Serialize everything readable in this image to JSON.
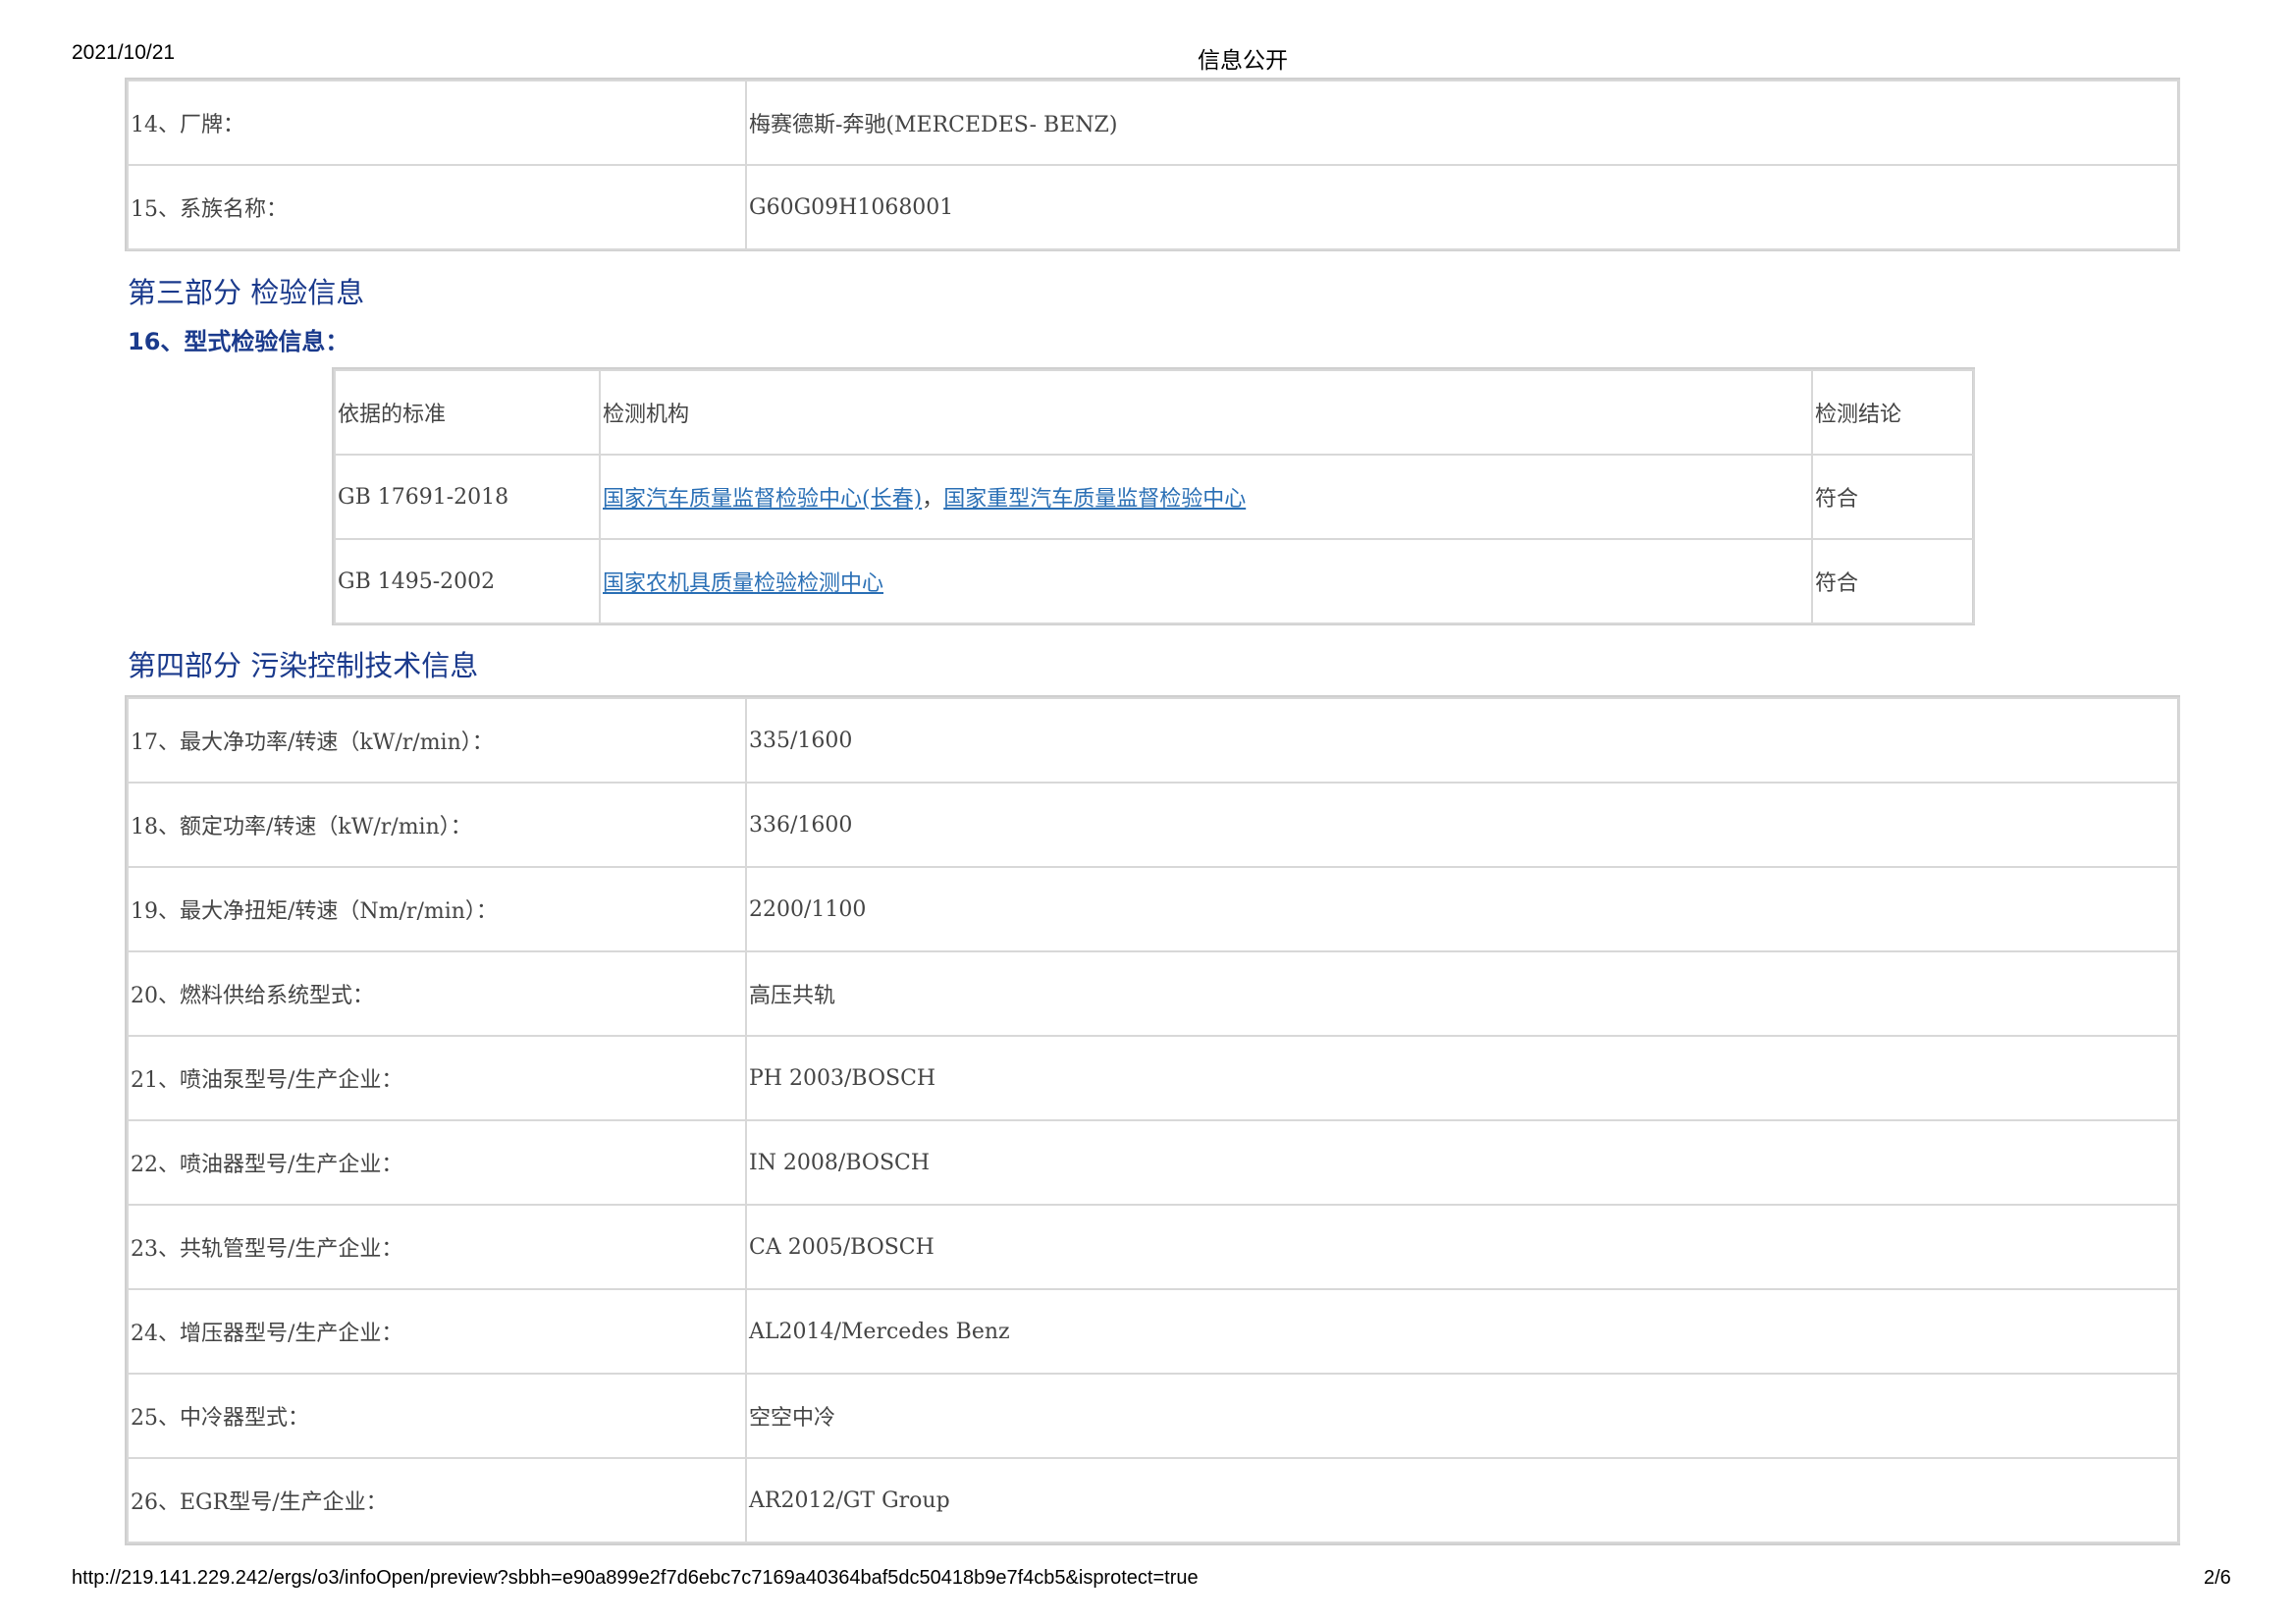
{
  "header": {
    "date": "2021/10/21",
    "title": "信息公开"
  },
  "footer": {
    "url": "http://219.141.229.242/ergs/o3/infoOpen/preview?sbbh=e90a899e2f7d6ebc7c7169a40364baf5dc50418b9e7f4cb5&isprotect=true",
    "page": "2/6"
  },
  "part2_rows": [
    {
      "label": "14、厂牌：",
      "value": "梅赛德斯-奔驰(MERCEDES- BENZ)"
    },
    {
      "label": "15、系族名称：",
      "value": "G60G09H1068001"
    }
  ],
  "part3": {
    "title": "第三部分 检验信息",
    "subtitle": "16、型式检验信息：",
    "headers": {
      "standard": "依据的标准",
      "agency": "检测机构",
      "result": "检测结论"
    },
    "rows": [
      {
        "standard": "GB 17691-2018",
        "agency_link1": "国家汽车质量监督检验中心(长春)",
        "separator": "，",
        "agency_link2": "国家重型汽车质量监督检验中心",
        "result": "符合"
      },
      {
        "standard": "GB 1495-2002",
        "agency_link1": "国家农机具质量检验检测中心",
        "result": "符合"
      }
    ]
  },
  "part4": {
    "title": "第四部分 污染控制技术信息",
    "rows": [
      {
        "label": "17、最大净功率/转速（kW/r/min）：",
        "value": "335/1600"
      },
      {
        "label": "18、额定功率/转速（kW/r/min）：",
        "value": "336/1600"
      },
      {
        "label": "19、最大净扭矩/转速（Nm/r/min）：",
        "value": "2200/1100"
      },
      {
        "label": "20、燃料供给系统型式：",
        "value": "高压共轨"
      },
      {
        "label": "21、喷油泵型号/生产企业：",
        "value": "PH 2003/BOSCH"
      },
      {
        "label": "22、喷油器型号/生产企业：",
        "value": "IN 2008/BOSCH"
      },
      {
        "label": "23、共轨管型号/生产企业：",
        "value": "CA 2005/BOSCH"
      },
      {
        "label": "24、增压器型号/生产企业：",
        "value": "AL2014/Mercedes Benz"
      },
      {
        "label": "25、中冷器型式：",
        "value": "空空中冷"
      },
      {
        "label": "26、EGR型号/生产企业：",
        "value": "AR2012/GT Group"
      }
    ]
  },
  "colors": {
    "heading": "#1a3a8c",
    "link": "#2a6fb5",
    "cell_text": "#444444",
    "border": "#d8d8d8"
  }
}
